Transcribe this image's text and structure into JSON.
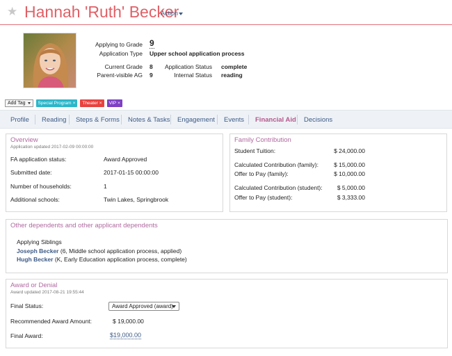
{
  "header": {
    "student_name": "Hannah 'Ruth' Becker",
    "action_label": "Action",
    "favorite_icon": "star-icon"
  },
  "profile": {
    "applying_to_grade_label": "Applying to Grade",
    "applying_to_grade_value": "9",
    "application_type_label": "Application Type",
    "application_type_value": "Upper school application process",
    "current_grade_label": "Current Grade",
    "current_grade_value": "8",
    "application_status_label": "Application Status",
    "application_status_value": "complete",
    "parent_visible_ag_label": "Parent-visible AG",
    "parent_visible_ag_value": "9",
    "internal_status_label": "Internal Status",
    "internal_status_value": "reading"
  },
  "tags": {
    "add_tag_label": "Add Tag",
    "items": [
      {
        "label": "Special Program",
        "color": "#2bb6c9"
      },
      {
        "label": "Theater",
        "color": "#e8423f"
      },
      {
        "label": "VIP",
        "color": "#7e3fc4"
      }
    ],
    "remove_symbol": "×"
  },
  "tabs": [
    {
      "label": "Profile"
    },
    {
      "label": "Reading"
    },
    {
      "label": "Steps & Forms"
    },
    {
      "label": "Notes & Tasks"
    },
    {
      "label": "Engagement"
    },
    {
      "label": "Events"
    },
    {
      "label": "Financial Aid"
    },
    {
      "label": "Decisions"
    }
  ],
  "active_tab": "Financial Aid",
  "overview": {
    "title": "Overview",
    "subtitle": "Application updated 2017-02-09 00:00:00",
    "rows": [
      {
        "label": "FA application status:",
        "value": "Award Approved"
      },
      {
        "label": "Submitted date:",
        "value": "2017-01-15 00:00:00"
      },
      {
        "label": "Number of households:",
        "value": "1"
      },
      {
        "label": "Additional schools:",
        "value": "Twin Lakes, Springbrook"
      }
    ]
  },
  "family_contribution": {
    "title": "Family Contribution",
    "rows": [
      {
        "label": "Student Tuition:",
        "value": "$ 24,000.00"
      },
      {
        "label": "Calculated Contribution (family):",
        "value": "$ 15,000.00"
      },
      {
        "label": "Offer to Pay (family):",
        "value": "$ 10,000.00"
      },
      {
        "label": "Calculated Contribution (student):",
        "value": "$ 5,000.00"
      },
      {
        "label": "Offer to Pay (student):",
        "value": "$ 3,333.00"
      }
    ]
  },
  "dependents": {
    "title": "Other dependents and other applicant dependents",
    "section_label": "Applying Siblings",
    "siblings": [
      {
        "name": "Joseph Becker",
        "detail": "(6, Middle school application process, applied)"
      },
      {
        "name": "Hugh Becker",
        "detail": "(K, Early Education application process, complete)"
      }
    ]
  },
  "award": {
    "title": "Award or Denial",
    "subtitle": "Award updated 2017-08-21 19:55:44",
    "final_status_label": "Final Status:",
    "final_status_value": "Award Approved (award)",
    "recommended_label": "Recommended Award Amount:",
    "recommended_value": "$ 19,000.00",
    "final_award_label": "Final Award:",
    "final_award_value": "$19,000.00"
  }
}
